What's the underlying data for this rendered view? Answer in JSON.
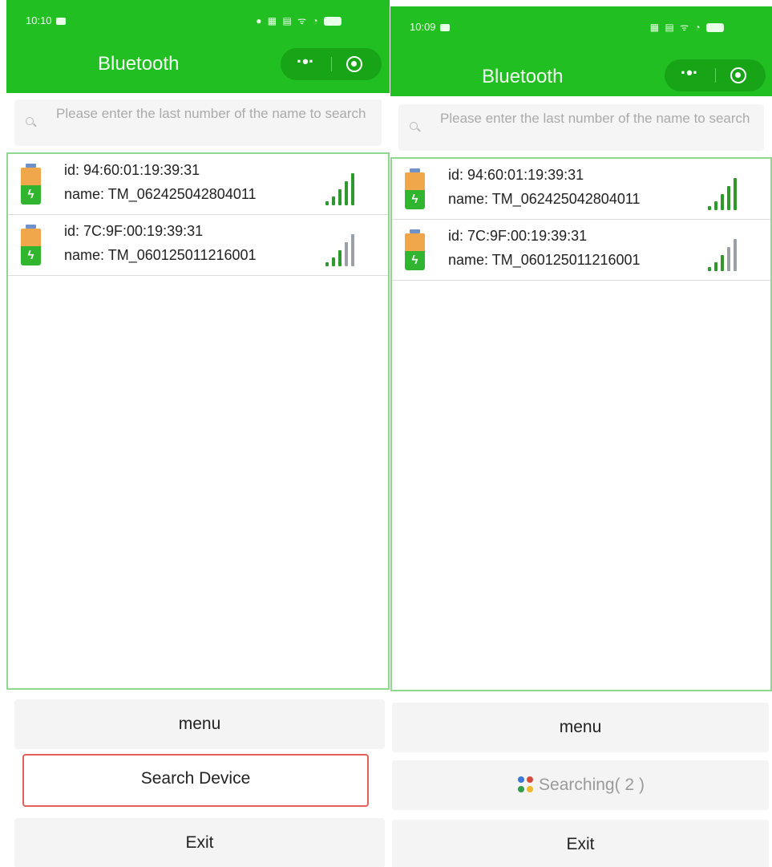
{
  "screens": [
    {
      "status": {
        "time": "10:10"
      },
      "header": {
        "title": "Bluetooth",
        "more_label": "·•·"
      },
      "search": {
        "placeholder": "Please enter the last number of the name to search"
      },
      "devices": [
        {
          "id": "id: 94:60:01:19:39:31",
          "name": "name: TM_062425042804011",
          "signal": "strong"
        },
        {
          "id": "id: 7C:9F:00:19:39:31",
          "name": "name: TM_060125011216001",
          "signal": "medium"
        }
      ],
      "buttons": {
        "menu": "menu",
        "search": "Search Device",
        "exit": "Exit"
      }
    },
    {
      "status": {
        "time": "10:09"
      },
      "header": {
        "title": "Bluetooth",
        "more_label": "·•·"
      },
      "search": {
        "placeholder": "Please enter the last number of the name to search"
      },
      "devices": [
        {
          "id": "id: 94:60:01:19:39:31",
          "name": "name: TM_062425042804011",
          "signal": "strong"
        },
        {
          "id": "id: 7C:9F:00:19:39:31",
          "name": "name: TM_060125011216001",
          "signal": "medium"
        }
      ],
      "buttons": {
        "menu": "menu",
        "searching": "Searching(  2  )",
        "exit": "Exit"
      }
    }
  ],
  "colors": {
    "header_green": "#22bf22",
    "signal_green": "#2e9a2e",
    "highlight_red": "#e2605a",
    "battery_orange": "#f0a64b",
    "battery_green": "#31b531"
  },
  "icons": [
    "search-icon",
    "battery-charging-icon",
    "signal-strength-icon",
    "more-dots-icon",
    "target-icon",
    "loading-dots-icon"
  ]
}
